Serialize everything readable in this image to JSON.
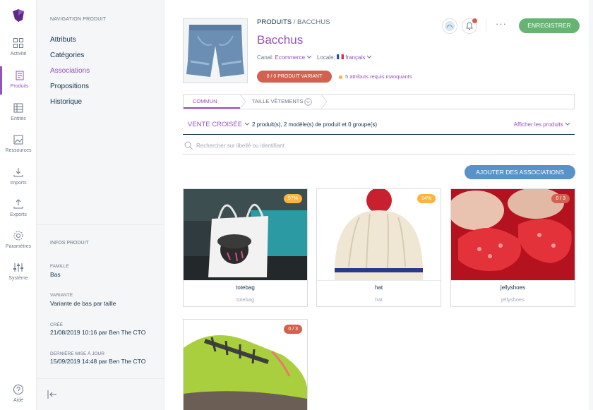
{
  "menu": {
    "items": [
      {
        "label": "Activité",
        "icon": "dashboard-icon"
      },
      {
        "label": "Produits",
        "icon": "products-icon"
      },
      {
        "label": "Entités",
        "icon": "entities-icon"
      },
      {
        "label": "Ressources",
        "icon": "assets-icon"
      },
      {
        "label": "Imports",
        "icon": "import-icon"
      },
      {
        "label": "Exports",
        "icon": "export-icon"
      },
      {
        "label": "Paramètres",
        "icon": "gear-icon"
      },
      {
        "label": "Système",
        "icon": "sliders-icon"
      }
    ],
    "help": "Aide"
  },
  "column": {
    "title": "NAVIGATION PRODUIT",
    "links": [
      "Attributs",
      "Catégories",
      "Associations",
      "Propositions",
      "Historique"
    ],
    "active_link": "Associations",
    "info_title": "INFOS PRODUIT",
    "family_label": "FAMILLE",
    "family_value": "Bas",
    "variant_label": "VARIANTE",
    "variant_value": "Variante de bas par taille",
    "created_label": "CRÉÉ",
    "created_value": "21/08/2019 10:16 par Ben The CTO",
    "updated_label": "DERNIÈRE MISE À JOUR",
    "updated_value": "15/09/2019 14:48 par Ben The CTO"
  },
  "header": {
    "breadcrumb_root": "PRODUITS",
    "breadcrumb_sep": " / ",
    "breadcrumb_current": "BACCHUS",
    "title": "Bacchus",
    "channel_label": "Canal:",
    "channel_value": "Ecommerce",
    "locale_label": "Locale:",
    "locale_value": "français",
    "variant_badge": "0 / 0 PRODUIT VARIANT",
    "missing": "5 attributs requis manquants",
    "save_label": "ENREGISTRER",
    "more_label": "···",
    "colors": {
      "accent": "#9452ba",
      "save": "#67b373",
      "danger": "#d4604f",
      "warning": "#f9b53f",
      "blue": "#5992c7"
    }
  },
  "tabs": [
    "COMMUN",
    "TAILLE VÊTEMENTS"
  ],
  "association": {
    "type": "VENTE CROISÉE",
    "count": "2 produit(s), 2 modèle(s) de produit et 0 groupe(s)",
    "show_products": "Afficher les produits",
    "search_placeholder": "Rechercher sur libellé ou identifiant",
    "add_label": "AJOUTER DES ASSOCIATIONS"
  },
  "cards": [
    {
      "label": "totebag",
      "sub": "totebag",
      "badge": "57%",
      "badge_type": "warning"
    },
    {
      "label": "hat",
      "sub": "hat",
      "badge": "14%",
      "badge_type": "warning"
    },
    {
      "label": "jellyshoes",
      "sub": "jellyshoes",
      "badge": "0 / 3",
      "badge_type": "danger"
    },
    {
      "label": "",
      "sub": "",
      "badge": "0 / 3",
      "badge_type": "danger"
    }
  ]
}
